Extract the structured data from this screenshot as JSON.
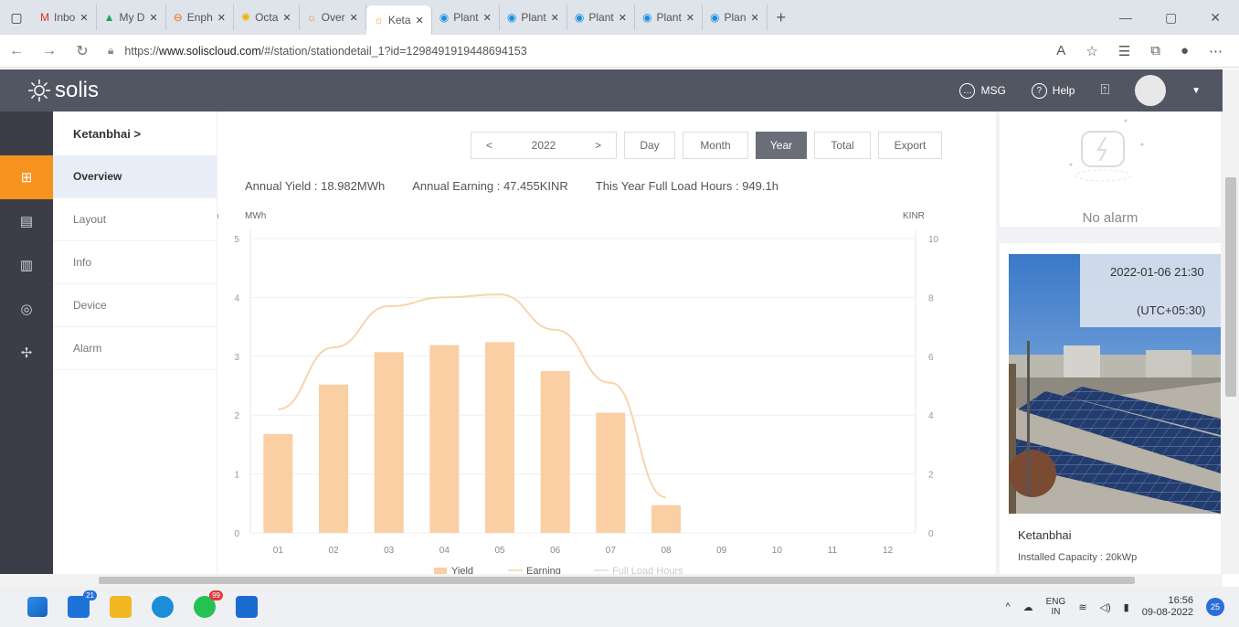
{
  "browser": {
    "tabs": [
      {
        "label": "Inbo",
        "color": "#d93025",
        "glyph": "M"
      },
      {
        "label": "My D",
        "color": "#1aa260",
        "glyph": "▲"
      },
      {
        "label": "Enph",
        "color": "#f36c21",
        "glyph": "⊖"
      },
      {
        "label": "Octa",
        "color": "#f0b400",
        "glyph": "✺"
      },
      {
        "label": "Over",
        "color": "#f5931e",
        "glyph": "☼"
      },
      {
        "label": "Keta",
        "color": "#f5931e",
        "glyph": "☼"
      },
      {
        "label": "Plant",
        "color": "#1c8fe0",
        "glyph": "◉"
      },
      {
        "label": "Plant",
        "color": "#1c8fe0",
        "glyph": "◉"
      },
      {
        "label": "Plant",
        "color": "#1c8fe0",
        "glyph": "◉"
      },
      {
        "label": "Plant",
        "color": "#1c8fe0",
        "glyph": "◉"
      },
      {
        "label": "Plan",
        "color": "#1c8fe0",
        "glyph": "◉"
      }
    ],
    "active_tab": 5,
    "url_prefix": "https://",
    "url_domain": "www.soliscloud.com",
    "url_rest": "/#/station/stationdetail_1?id=1298491919448694153"
  },
  "header": {
    "logo": "solis",
    "msg": "MSG",
    "help": "Help"
  },
  "subnav": {
    "station": "Ketanbhai >",
    "items": [
      "Overview",
      "Layout",
      "Info",
      "Device",
      "Alarm"
    ],
    "active": 0
  },
  "toolbar": {
    "prev": "<",
    "year": "2022",
    "next": ">",
    "day": "Day",
    "month": "Month",
    "year_btn": "Year",
    "total": "Total",
    "export": "Export",
    "selected": "Year"
  },
  "stats": {
    "yield": "Annual Yield : 18.982MWh",
    "earning": "Annual Earning : 47.455KINR",
    "hours": "This Year Full Load Hours : 949.1h"
  },
  "chart_data": {
    "type": "bar",
    "categories": [
      "01",
      "02",
      "03",
      "04",
      "05",
      "06",
      "07",
      "08",
      "09",
      "10",
      "11",
      "12"
    ],
    "series": [
      {
        "name": "Yield",
        "type": "bar",
        "values": [
          1.68,
          2.52,
          3.07,
          3.19,
          3.24,
          2.75,
          2.04,
          0.47,
          null,
          null,
          null,
          null
        ],
        "color": "#f9cfa3"
      },
      {
        "name": "Earning",
        "type": "line",
        "values": [
          4.2,
          6.3,
          7.7,
          8.0,
          8.1,
          6.9,
          5.1,
          1.2,
          null,
          null,
          null,
          null
        ],
        "color": "#f6d5ad"
      },
      {
        "name": "Full Load Hours",
        "type": "line",
        "values": [],
        "color": "#dddddd"
      }
    ],
    "ylabel_left": "MWh",
    "ylabel_right": "KINR",
    "ylim_left": [
      0,
      5
    ],
    "ylim_right": [
      0,
      10
    ],
    "yticks_left": [
      "0",
      "1",
      "2",
      "3",
      "4",
      "5"
    ],
    "yticks_right": [
      "0",
      "2",
      "4",
      "6",
      "8",
      "10"
    ],
    "left_partial": "h",
    "grid": true,
    "legend_position": "bottom"
  },
  "alarm": {
    "text": "No alarm"
  },
  "station_card": {
    "time": "2022-01-06 21:30",
    "tz": "(UTC+05:30)",
    "name": "Ketanbhai",
    "capacity": "Installed Capacity : 20kWp"
  },
  "taskbar": {
    "badge1": "21",
    "badge2": "99",
    "lang1": "ENG",
    "lang2": "IN",
    "time": "16:56",
    "date": "09-08-2022",
    "notif": "25"
  }
}
